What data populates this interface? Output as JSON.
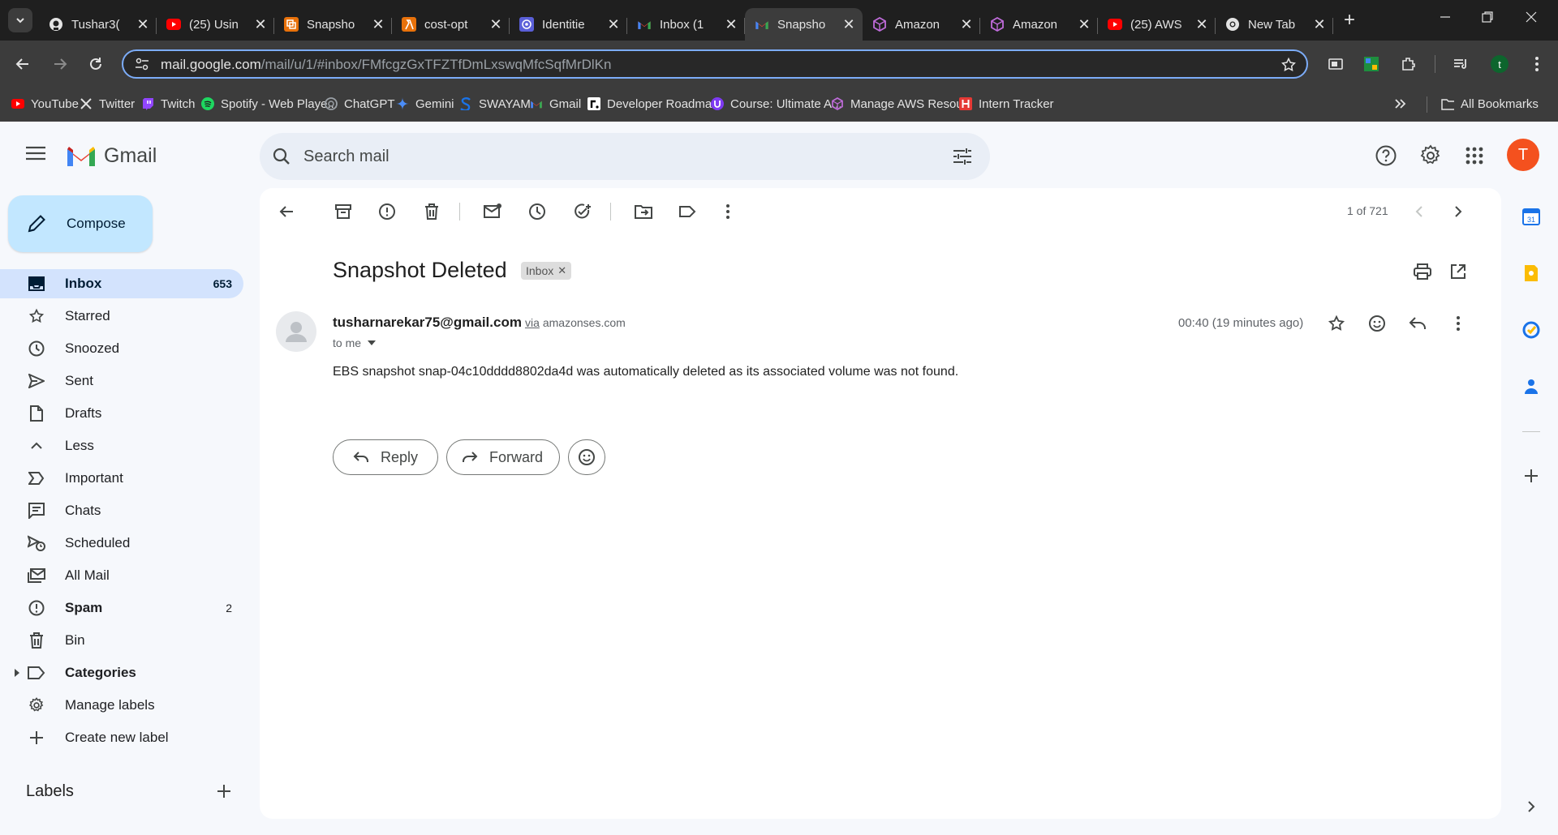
{
  "browser": {
    "tabs": [
      {
        "title": "Tushar3(",
        "favicon": "github-icon",
        "active": false
      },
      {
        "title": "(25) Usin",
        "favicon": "youtube-icon",
        "active": false
      },
      {
        "title": "Snapsho",
        "favicon": "aws-orange-icon",
        "active": false
      },
      {
        "title": "cost-opt",
        "favicon": "aws-lambda-icon",
        "active": false
      },
      {
        "title": "Identitie",
        "favicon": "aws-iam-icon",
        "active": false
      },
      {
        "title": "Inbox (1",
        "favicon": "gmail-icon",
        "active": false
      },
      {
        "title": "Snapsho",
        "favicon": "gmail-icon",
        "active": true
      },
      {
        "title": "Amazon",
        "favicon": "aws-cube-icon",
        "active": false
      },
      {
        "title": "Amazon",
        "favicon": "aws-cube-icon",
        "active": false
      },
      {
        "title": "(25) AWS",
        "favicon": "youtube-icon",
        "active": false
      },
      {
        "title": "New Tab",
        "favicon": "chrome-icon",
        "active": false
      }
    ],
    "url_host": "mail.google.com",
    "url_path": "/mail/u/1/#inbox/FMfcgzGxTFZTfDmLxswqMfcSqfMrDlKn",
    "profile_initial": "t",
    "bookmarks": [
      {
        "label": "YouTube",
        "icon": "youtube-icon",
        "color": "#ff0000"
      },
      {
        "label": "Twitter",
        "icon": "x-icon",
        "color": "#000000"
      },
      {
        "label": "Twitch",
        "icon": "twitch-icon",
        "color": "#9146ff"
      },
      {
        "label": "Spotify - Web Playe...",
        "icon": "spotify-icon",
        "color": "#1ed760"
      },
      {
        "label": "ChatGPT",
        "icon": "chatgpt-icon",
        "color": "#9aa0a6"
      },
      {
        "label": "Gemini",
        "icon": "gemini-icon",
        "color": "#4b8df8"
      },
      {
        "label": "SWAYAM",
        "icon": "swayam-icon",
        "color": "#1a73e8"
      },
      {
        "label": "Gmail",
        "icon": "gmail-icon",
        "color": "#ea4335"
      },
      {
        "label": "Developer Roadma...",
        "icon": "roadmap-icon",
        "color": "#000000"
      },
      {
        "label": "Course: Ultimate A...",
        "icon": "course-icon",
        "color": "#7e3af2"
      },
      {
        "label": "Manage AWS Resou...",
        "icon": "aws-cube-icon",
        "color": "#c06cdb"
      },
      {
        "label": "Intern Tracker",
        "icon": "intern-tracker-icon",
        "color": "#e53935"
      }
    ],
    "all_bookmarks_label": "All Bookmarks"
  },
  "gmail": {
    "logo_text": "Gmail",
    "search_placeholder": "Search mail",
    "account_initial": "T",
    "compose_label": "Compose",
    "nav": [
      {
        "label": "Inbox",
        "count": "653",
        "icon": "inbox-icon",
        "active": true
      },
      {
        "label": "Starred",
        "count": "",
        "icon": "star-icon"
      },
      {
        "label": "Snoozed",
        "count": "",
        "icon": "clock-icon"
      },
      {
        "label": "Sent",
        "count": "",
        "icon": "send-icon"
      },
      {
        "label": "Drafts",
        "count": "",
        "icon": "draft-icon"
      },
      {
        "label": "Less",
        "count": "",
        "icon": "chevron-up-icon"
      },
      {
        "label": "Important",
        "count": "",
        "icon": "important-icon"
      },
      {
        "label": "Chats",
        "count": "",
        "icon": "chat-icon"
      },
      {
        "label": "Scheduled",
        "count": "",
        "icon": "scheduled-icon"
      },
      {
        "label": "All Mail",
        "count": "",
        "icon": "all-mail-icon"
      },
      {
        "label": "Spam",
        "count": "2",
        "icon": "spam-icon",
        "bold": true
      },
      {
        "label": "Bin",
        "count": "",
        "icon": "bin-icon"
      },
      {
        "label": "Categories",
        "count": "",
        "icon": "label-icon",
        "bold": true
      },
      {
        "label": "Manage labels",
        "count": "",
        "icon": "gear-icon"
      },
      {
        "label": "Create new label",
        "count": "",
        "icon": "plus-icon"
      }
    ],
    "labels_heading": "Labels",
    "pagination": "1 of 721",
    "message": {
      "subject": "Snapshot Deleted",
      "chip": "Inbox",
      "sender": "tusharnarekar75@gmail.com",
      "via": "via",
      "via_domain": "amazonses.com",
      "to": "to me",
      "time": "00:40 (19 minutes ago)",
      "body": "EBS snapshot snap-04c10dddd8802da4d was automatically deleted as its associated volume was not found."
    },
    "reply_label": "Reply",
    "forward_label": "Forward"
  }
}
